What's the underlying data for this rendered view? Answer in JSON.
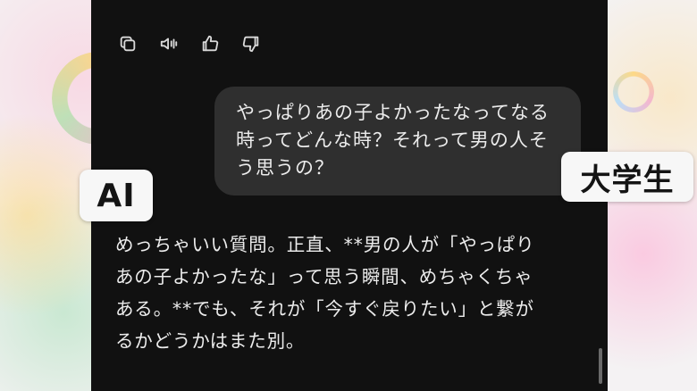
{
  "actions": {
    "copy_icon": "copy-icon",
    "read_aloud_icon": "speaker-icon",
    "thumbs_up_icon": "thumbs-up-icon",
    "thumbs_down_icon": "thumbs-down-icon"
  },
  "user_message": "やっぱりあの子よかったなってなる\n時ってどんな時？それって男の人そ\nう思うの？",
  "ai_message": "めっちゃいい質問。正直、**男の人が「やっぱり\nあの子よかったな」って思う瞬間、めちゃくちゃ\nある。**でも、それが「今すぐ戻りたい」と繋が\nるかどうかはまた別。",
  "labels": {
    "ai": "AI",
    "user": "大学生"
  },
  "colors": {
    "chat_background": "#111111",
    "bubble": "#2f2f2f",
    "text": "#ececec",
    "label_bg": "#f7f7f7"
  }
}
